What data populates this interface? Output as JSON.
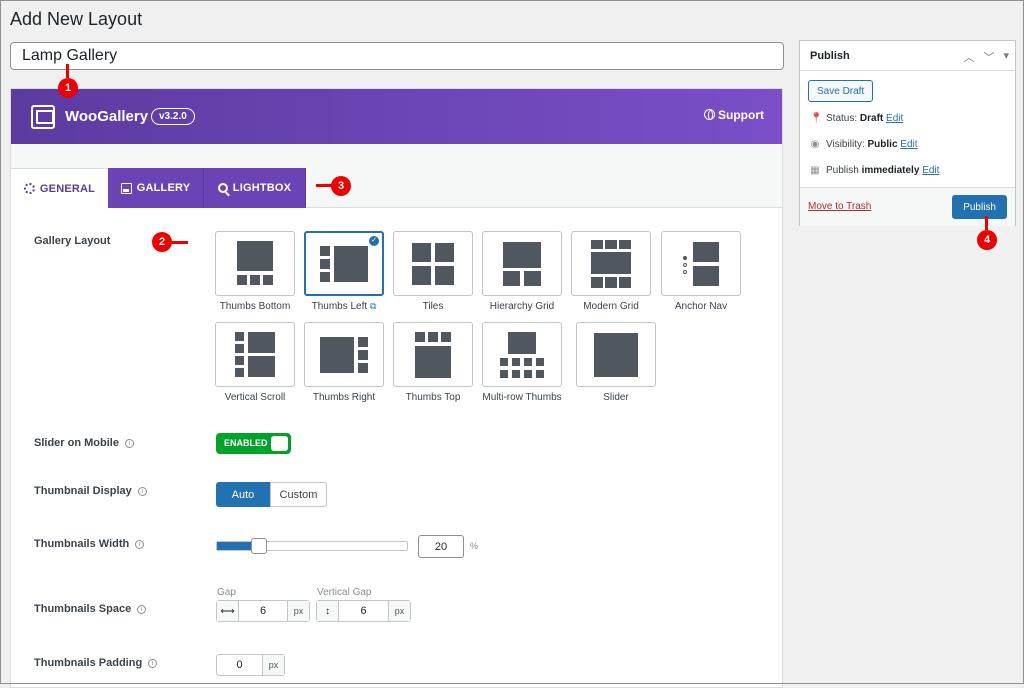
{
  "page_title": "Add New Layout",
  "title_input": {
    "value": "Lamp Gallery"
  },
  "plugin": {
    "name": "WooGallery",
    "version": "v3.2.0",
    "support_label": "Support"
  },
  "tabs": [
    {
      "label": "GENERAL",
      "icon": "gear-icon",
      "active": true
    },
    {
      "label": "GALLERY",
      "icon": "image-icon",
      "active": false
    },
    {
      "label": "LIGHTBOX",
      "icon": "search-icon",
      "active": false
    }
  ],
  "settings": {
    "gallery_layout": {
      "label": "Gallery Layout",
      "options": [
        {
          "label": "Thumbs Bottom",
          "selected": false
        },
        {
          "label": "Thumbs Left",
          "selected": true,
          "external_link": true
        },
        {
          "label": "Tiles",
          "selected": false
        },
        {
          "label": "Hierarchy Grid",
          "selected": false
        },
        {
          "label": "Modern Grid",
          "selected": false
        },
        {
          "label": "Anchor Nav",
          "selected": false
        },
        {
          "label": "Vertical Scroll",
          "selected": false
        },
        {
          "label": "Thumbs Right",
          "selected": false
        },
        {
          "label": "Thumbs Top",
          "selected": false
        },
        {
          "label": "Multi-row Thumbs",
          "selected": false
        },
        {
          "label": "Slider",
          "selected": false
        }
      ]
    },
    "slider_on_mobile": {
      "label": "Slider on Mobile",
      "state": "ENABLED"
    },
    "thumbnail_display": {
      "label": "Thumbnail Display",
      "options": [
        "Auto",
        "Custom"
      ],
      "selected": "Auto"
    },
    "thumbnails_width": {
      "label": "Thumbnails Width",
      "value": "20",
      "unit": "%",
      "fill_fraction": 0.2
    },
    "thumbnails_space": {
      "label": "Thumbnails Space",
      "gap_label": "Gap",
      "gap_value": "6",
      "gap_unit": "px",
      "vgap_label": "Vertical Gap",
      "vgap_value": "6",
      "vgap_unit": "px"
    },
    "thumbnails_padding": {
      "label": "Thumbnails Padding",
      "value": "0",
      "unit": "px"
    }
  },
  "publish": {
    "title": "Publish",
    "save_draft": "Save Draft",
    "status_label": "Status:",
    "status_value": "Draft",
    "visibility_label": "Visibility:",
    "visibility_value": "Public",
    "publish_label": "Publish",
    "publish_value": "immediately",
    "edit_link": "Edit",
    "trash_link": "Move to Trash",
    "publish_button": "Publish"
  },
  "annotations": [
    "1",
    "2",
    "3",
    "4"
  ],
  "colors": {
    "accent": "#2271b1",
    "purple": "#6a44b4",
    "enabled": "#00a32a",
    "marker": "#ee0000"
  }
}
